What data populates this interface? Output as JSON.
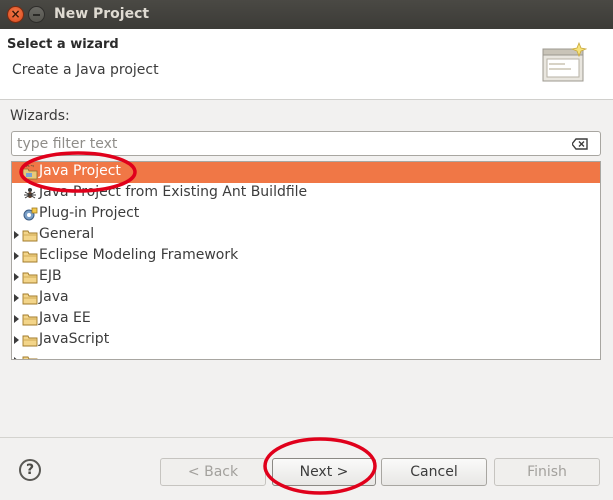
{
  "window": {
    "title": "New Project"
  },
  "header": {
    "title": "Select a wizard",
    "description": "Create a Java project"
  },
  "wizards_label": "Wizards:",
  "filter": {
    "placeholder": "type filter text",
    "value": ""
  },
  "tree": {
    "items": [
      {
        "label": "Java Project",
        "icon": "java-project-icon",
        "expandable": false,
        "selected": true
      },
      {
        "label": "Java Project from Existing Ant Buildfile",
        "icon": "ant-icon",
        "expandable": false,
        "selected": false
      },
      {
        "label": "Plug-in Project",
        "icon": "plugin-project-icon",
        "expandable": false,
        "selected": false
      },
      {
        "label": "General",
        "icon": "folder-icon",
        "expandable": true,
        "selected": false
      },
      {
        "label": "Eclipse Modeling Framework",
        "icon": "folder-icon",
        "expandable": true,
        "selected": false
      },
      {
        "label": "EJB",
        "icon": "folder-icon",
        "expandable": true,
        "selected": false
      },
      {
        "label": "Java",
        "icon": "folder-icon",
        "expandable": true,
        "selected": false
      },
      {
        "label": "Java EE",
        "icon": "folder-icon",
        "expandable": true,
        "selected": false
      },
      {
        "label": "JavaScript",
        "icon": "folder-icon",
        "expandable": true,
        "selected": false
      }
    ]
  },
  "buttons": {
    "help": "?",
    "back": "< Back",
    "next": "Next >",
    "cancel": "Cancel",
    "finish": "Finish"
  },
  "colors": {
    "selection": "#f07746",
    "annotation": "#e0001b"
  }
}
